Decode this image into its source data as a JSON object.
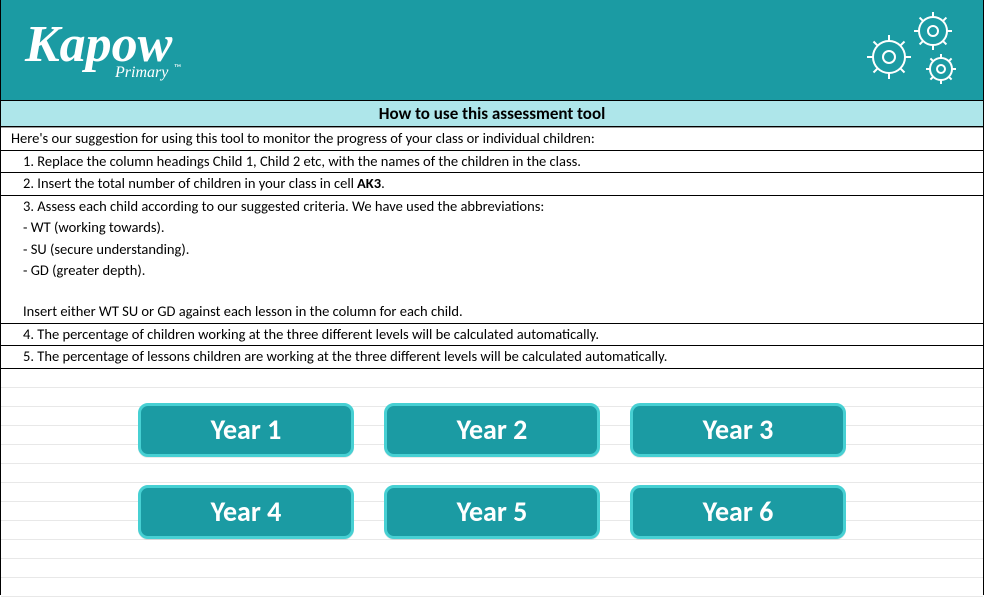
{
  "header": {
    "logo_text": "Kapow",
    "logo_sub": "Primary"
  },
  "title": "How to use this assessment tool",
  "rows": {
    "intro": "Here's our suggestion for using this tool to monitor the progress of your class or individual children:",
    "step1": "1. Replace the column headings Child 1, Child 2 etc, with the names of the children in the class.",
    "step2a": "2.  Insert the total number of children in your class in cell",
    "step2_key": "AK3",
    "step3": "3.  Assess each child according to our suggested criteria.  We have used the abbreviations:",
    "abbr_wt": "- WT (working towards).",
    "abbr_su": "- SU (secure understanding).",
    "abbr_gd": "- GD (greater depth).",
    "insert_line": "Insert either WT SU or GD against each lesson in the column for each child.",
    "step4": "4.  The percentage of children working at the three different levels will be calculated automatically.",
    "step5": "5. The percentage of lessons children are working at the three different levels will be calculated automatically."
  },
  "buttons": {
    "y1": "Year 1",
    "y2": "Year 2",
    "y3": "Year 3",
    "y4": "Year 4",
    "y5": "Year 5",
    "y6": "Year 6"
  }
}
